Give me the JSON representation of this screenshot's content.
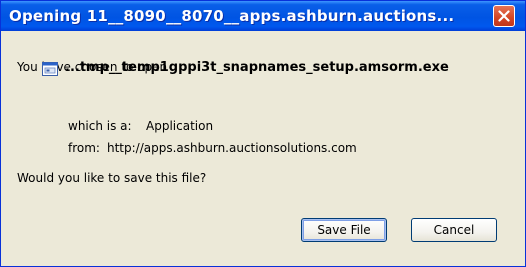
{
  "window": {
    "title": "Opening 11__8090__8070__apps.ashburn.auctions..."
  },
  "dialog": {
    "intro": "You have chosen to open",
    "filename": "...tmp__temp1gppi3t_snapnames_setup.amsorm.exe",
    "which_is_label": "which is a:",
    "which_is_value": "Application",
    "from_label": "from:",
    "from_value": "http://apps.ashburn.auctionsolutions.com",
    "question": "Would you like to save this file?"
  },
  "buttons": {
    "save": "Save File",
    "cancel": "Cancel"
  },
  "icons": {
    "close": "close-icon",
    "file": "application-file-icon"
  },
  "colors": {
    "titlebar": "#0054e3",
    "dialog_bg": "#ece9d8",
    "close_button": "#d44524"
  }
}
